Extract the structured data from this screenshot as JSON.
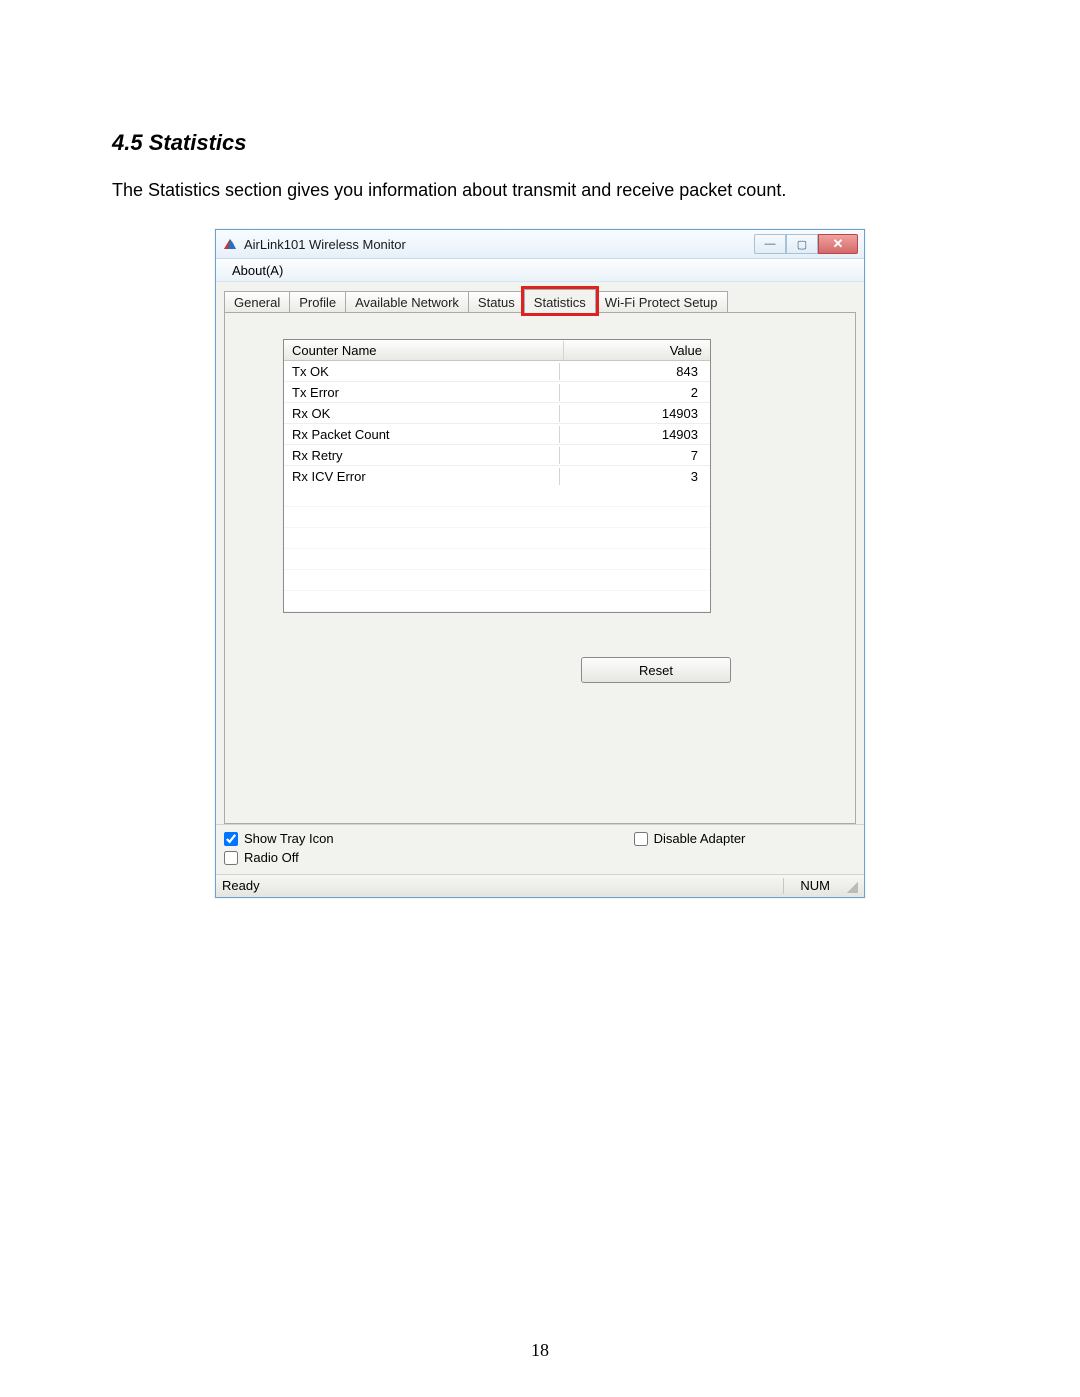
{
  "doc": {
    "heading": "4.5 Statistics",
    "body": "The Statistics section gives you information about transmit and receive packet count.",
    "page_number": "18"
  },
  "window": {
    "title": "AirLink101 Wireless Monitor",
    "minimize_glyph": "—",
    "maximize_glyph": "▢",
    "close_glyph": "✕"
  },
  "menu": {
    "about": "About(A)"
  },
  "tabs": {
    "general": "General",
    "profile": "Profile",
    "available_network": "Available Network",
    "status": "Status",
    "statistics": "Statistics",
    "wps": "Wi-Fi Protect Setup"
  },
  "table": {
    "header_name": "Counter Name",
    "header_value": "Value",
    "rows": [
      {
        "name": "Tx OK",
        "value": "843"
      },
      {
        "name": "Tx Error",
        "value": "2"
      },
      {
        "name": "Rx OK",
        "value": "14903"
      },
      {
        "name": "Rx Packet Count",
        "value": "14903"
      },
      {
        "name": "Rx Retry",
        "value": "7"
      },
      {
        "name": "Rx ICV Error",
        "value": "3"
      }
    ]
  },
  "buttons": {
    "reset": "Reset"
  },
  "checkboxes": {
    "show_tray": {
      "label": "Show Tray Icon",
      "checked": true
    },
    "disable_adapter": {
      "label": "Disable Adapter",
      "checked": false
    },
    "radio_off": {
      "label": "Radio Off",
      "checked": false
    }
  },
  "statusbar": {
    "ready": "Ready",
    "num": "NUM"
  }
}
